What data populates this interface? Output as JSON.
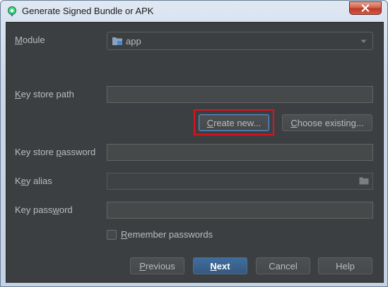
{
  "window": {
    "title": "Generate Signed Bundle or APK",
    "icon": "android-studio-icon",
    "close_icon": "close-icon"
  },
  "form": {
    "module": {
      "label_mnemonic": "M",
      "label_rest": "odule",
      "value": "app",
      "icon": "module-folder-icon"
    },
    "key_store_path": {
      "label_mnemonic": "K",
      "label_rest": "ey store path",
      "value": ""
    },
    "create_new": {
      "label_mnemonic": "C",
      "label_rest": "reate new..."
    },
    "choose_existing": {
      "label_mnemonic": "C",
      "label_rest": "hoose existing..."
    },
    "key_store_password": {
      "label_pre": "Key store ",
      "label_mnemonic": "p",
      "label_rest": "assword",
      "value": ""
    },
    "key_alias": {
      "label_pre": "K",
      "label_mnemonic": "e",
      "label_rest": "y alias",
      "value": "",
      "icon": "browse-folder-icon"
    },
    "key_password": {
      "label_pre": "Key pass",
      "label_mnemonic": "w",
      "label_rest": "ord",
      "value": ""
    },
    "remember_passwords": {
      "label_mnemonic": "R",
      "label_rest": "emember passwords",
      "checked": false
    }
  },
  "footer": {
    "previous": {
      "label_mnemonic": "P",
      "label_rest": "revious"
    },
    "next": {
      "label_mnemonic": "N",
      "label_rest": "ext"
    },
    "cancel": {
      "label": "Cancel"
    },
    "help": {
      "label": "Help"
    }
  },
  "colors": {
    "dialog_bg": "#3c3f41",
    "field_bg": "#45494a",
    "text": "#bbbbbb",
    "primary_button": "#365880",
    "highlight_box": "#e0121c"
  }
}
